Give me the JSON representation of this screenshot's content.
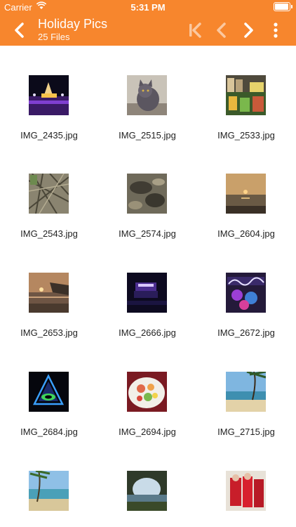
{
  "status_bar": {
    "carrier": "Carrier",
    "time": "5:31 PM",
    "battery_level": 0.95
  },
  "nav_bar": {
    "title": "Holiday Pics",
    "subtitle": "25 Files",
    "color": "#f7862d"
  },
  "files": [
    {
      "name": "IMG_2435.jpg"
    },
    {
      "name": "IMG_2515.jpg"
    },
    {
      "name": "IMG_2533.jpg"
    },
    {
      "name": "IMG_2543.jpg"
    },
    {
      "name": "IMG_2574.jpg"
    },
    {
      "name": "IMG_2604.jpg"
    },
    {
      "name": "IMG_2653.jpg"
    },
    {
      "name": "IMG_2666.jpg"
    },
    {
      "name": "IMG_2672.jpg"
    },
    {
      "name": "IMG_2684.jpg"
    },
    {
      "name": "IMG_2694.jpg"
    },
    {
      "name": "IMG_2715.jpg"
    },
    {
      "name": ""
    },
    {
      "name": ""
    },
    {
      "name": ""
    }
  ]
}
